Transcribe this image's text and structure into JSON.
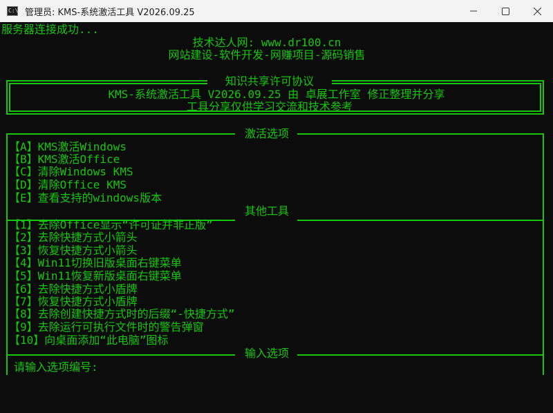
{
  "window": {
    "title": "管理员: KMS-系统激活工具 V2026.09.25",
    "icon": "cmd-icon",
    "controls": [
      "minimize-icon",
      "maximize-icon",
      "close-icon"
    ]
  },
  "console": {
    "status": "服务器连接成功...",
    "header_line1": "技术达人网: www.dr100.cn",
    "header_line2": "网站建设-软件开发-网赚项目-源码销售",
    "license": {
      "title": "知识共享许可协议",
      "line1": "KMS-系统激活工具 V2026.09.25 由 卓展工作室 修正整理并分享",
      "line2": "工具分享仅供学习交流和技术参考"
    },
    "activation": {
      "title": "激活选项",
      "items": [
        "【A】KMS激活Windows",
        "【B】KMS激活Office",
        "【C】清除Windows KMS",
        "【D】清除Office KMS",
        "【E】查看支持的windows版本"
      ]
    },
    "other_tools": {
      "title": "其他工具",
      "items": [
        "【1】去除Office显示“许可证并非正版”",
        "【2】去除快捷方式小箭头",
        "【3】恢复快捷方式小箭头",
        "【4】Win11切换旧版桌面右键菜单",
        "【5】Win11恢复新版桌面右键菜单",
        "【6】去除快捷方式小盾牌",
        "【7】恢复快捷方式小盾牌",
        "【8】去除创建快捷方式时的后缀“-快捷方式”",
        "【9】去除运行可执行文件时的警告弹窗",
        "【10】向桌面添加“此电脑”图标"
      ]
    },
    "input": {
      "title": "输入选项",
      "prompt": "请输入选项编号:"
    }
  }
}
